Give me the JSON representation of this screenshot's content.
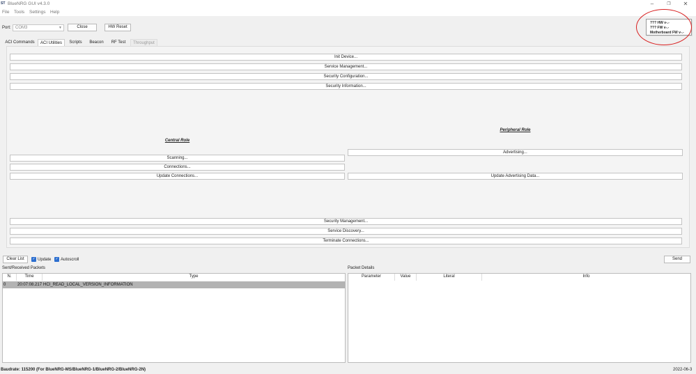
{
  "window": {
    "logo": "ST",
    "title": "BlueNRG GUI v4.3.0",
    "controls": {
      "minimize": "–",
      "maximize": "❐",
      "close": "✕"
    }
  },
  "menu": {
    "file": "File",
    "tools": "Tools",
    "settings": "Settings",
    "help": "Help"
  },
  "toolbar": {
    "port_label": "Port:",
    "port_value": "COM3",
    "close_label": "Close",
    "hw_reset_label": "HW Reset"
  },
  "firmware": {
    "hw": "??? HW v-.-",
    "fw": "??? FW v-.-",
    "motherboard": "Motherboard FW v-.-"
  },
  "highlight_color": "#d81f1f",
  "tabs": {
    "aci_commands": "ACI Commands",
    "aci_utilities": "ACI Utilities",
    "scripts": "Scripts",
    "beacon": "Beacon",
    "rf_test": "RF Test",
    "throughput": "Throughput"
  },
  "panel": {
    "init_device": "Init Device...",
    "service_management": "Service Management...",
    "security_configuration": "Security Configuration...",
    "security_information": "Security Information...",
    "central_role": "Central Role",
    "peripheral_role": "Peripheral Role",
    "scanning": "Scanning...",
    "connections": "Connections...",
    "update_connections": "Update Connections...",
    "advertising": "Advertising...",
    "update_advertising_data": "Update Advertising  Data...",
    "security_management": "Security Management...",
    "service_discovery": "Service Discovery...",
    "terminate_connections": "Terminate Connections..."
  },
  "controls": {
    "clear_list": "Clear List",
    "update": "Update",
    "autoscroll": "Autoscroll",
    "send": "Send"
  },
  "packets": {
    "title": "Sent/Received Packets",
    "columns": {
      "n": "N.",
      "time": "Time",
      "type": "Type"
    },
    "rows": [
      {
        "n": "0",
        "time": "20:07:08.217",
        "type": "HCI_READ_LOCAL_VERSION_INFORMATION"
      }
    ]
  },
  "packet_details": {
    "title": "Packet Details",
    "columns": {
      "parameter": "Parameter",
      "value": "Value",
      "literal": "Literal",
      "info": "Info"
    }
  },
  "status": {
    "baudrate": "Baudrate: 115200 (For BlueNRG-MS/BlueNRG-1/BlueNRG-2/BlueNRG-2N)",
    "date": "2022-06-3"
  }
}
